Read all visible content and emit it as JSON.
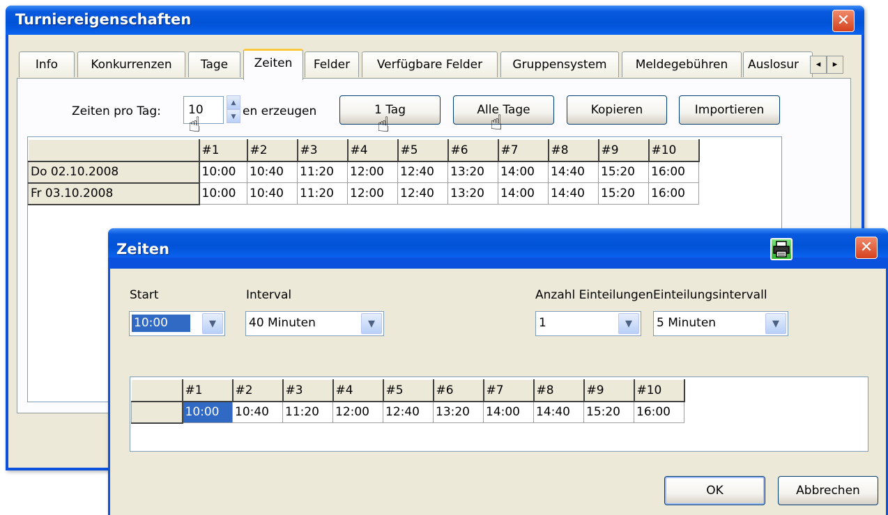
{
  "main_window": {
    "title": "Turniereigenschaften",
    "close_glyph": "✕",
    "tabs": [
      {
        "label": "Info"
      },
      {
        "label": "Konkurrenzen"
      },
      {
        "label": "Tage"
      },
      {
        "label": "Zeiten"
      },
      {
        "label": "Felder"
      },
      {
        "label": "Verfügbare Felder"
      },
      {
        "label": "Gruppensystem"
      },
      {
        "label": "Meldegebühren"
      },
      {
        "label": "Auslosur"
      }
    ],
    "tab_scroll_left": "◂",
    "tab_scroll_right": "▸",
    "zeiten_pro_tag_label": "Zeiten pro Tag:",
    "zeiten_pro_tag_value": "10",
    "erzeugen_label": "en erzeugen",
    "buttons": {
      "one_day": "1 Tag",
      "all_days": "Alle Tage",
      "copy": "Kopieren",
      "import": "Importieren"
    },
    "grid": {
      "columns": [
        "#1",
        "#2",
        "#3",
        "#4",
        "#5",
        "#6",
        "#7",
        "#8",
        "#9",
        "#10"
      ],
      "rows": [
        {
          "date": "Do 02.10.2008",
          "times": [
            "10:00",
            "10:40",
            "11:20",
            "12:00",
            "12:40",
            "13:20",
            "14:00",
            "14:40",
            "15:20",
            "16:00"
          ]
        },
        {
          "date": "Fr 03.10.2008",
          "times": [
            "10:00",
            "10:40",
            "11:20",
            "12:00",
            "12:40",
            "13:20",
            "14:00",
            "14:40",
            "15:20",
            "16:00"
          ]
        }
      ]
    }
  },
  "dialog": {
    "title": "Zeiten",
    "close_glyph": "✕",
    "print_icon": "printer-icon",
    "start_label": "Start",
    "start_value": "10:00",
    "interval_label": "Interval",
    "interval_value": "40 Minuten",
    "anzahl_label": "Anzahl Einteilungen",
    "anzahl_value": "1",
    "einteilungsintervall_label": "Einteilungsintervall",
    "einteilungsintervall_value": "5 Minuten",
    "dropdown_glyph": "▼",
    "grid": {
      "columns": [
        "#1",
        "#2",
        "#3",
        "#4",
        "#5",
        "#6",
        "#7",
        "#8",
        "#9",
        "#10"
      ],
      "times": [
        "10:00",
        "10:40",
        "11:20",
        "12:00",
        "12:40",
        "13:20",
        "14:00",
        "14:40",
        "15:20",
        "16:00"
      ]
    },
    "ok_label": "OK",
    "cancel_label": "Abbrechen"
  },
  "cursor_glyph": "☝"
}
